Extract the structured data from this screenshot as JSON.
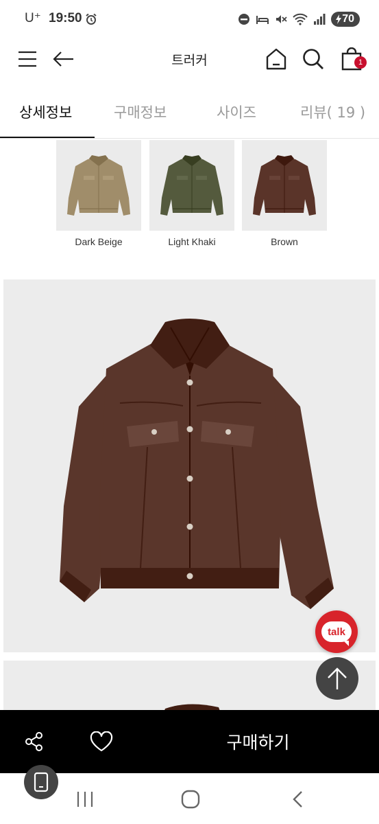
{
  "status_bar": {
    "carrier": "U⁺",
    "time": "19:50",
    "battery": "70",
    "icons": [
      "alarm-icon",
      "do-not-disturb-icon",
      "sleep-icon",
      "mute-icon",
      "wifi-icon",
      "signal-icon",
      "battery-icon"
    ]
  },
  "header": {
    "title": "트러커",
    "cart_count": "1",
    "icons": [
      "menu-icon",
      "back-arrow-icon",
      "home-icon",
      "search-icon",
      "shopping-bag-icon"
    ]
  },
  "tabs": [
    {
      "label": "상세정보",
      "active": true
    },
    {
      "label": "구매정보",
      "active": false
    },
    {
      "label": "사이즈",
      "active": false
    },
    {
      "label": "리뷰( 19 )",
      "active": false
    }
  ],
  "swatches": [
    {
      "label": "Dark Beige",
      "color": "#a08d6a"
    },
    {
      "label": "Light Khaki",
      "color": "#545a3d"
    },
    {
      "label": "Brown",
      "color": "#5a3429"
    }
  ],
  "product": {
    "main_color": "#5a362b",
    "background": "#ececec"
  },
  "floating": {
    "talk_label": "talk",
    "top_icon": "arrow-up-icon"
  },
  "purchase_bar": {
    "buy_label": "구매하기",
    "icons": [
      "share-icon",
      "heart-icon"
    ]
  },
  "nav_bar": {
    "icons": [
      "recent-apps-icon",
      "home-circle-icon",
      "back-chevron-icon",
      "screenshot-icon"
    ]
  }
}
